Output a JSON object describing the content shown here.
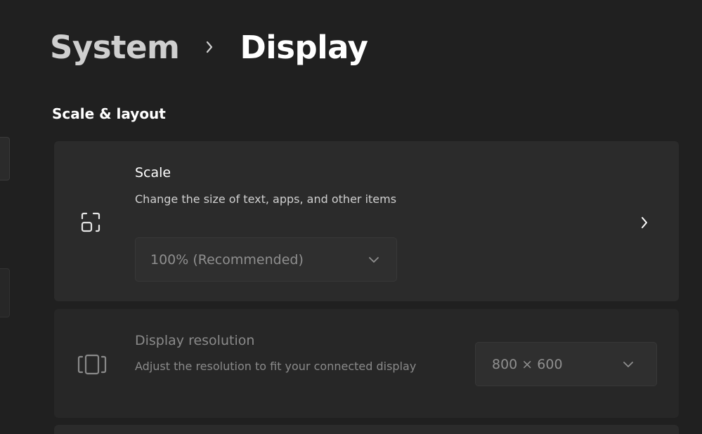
{
  "breadcrumb": {
    "parent": "System",
    "current": "Display"
  },
  "section": {
    "title": "Scale & layout"
  },
  "scale": {
    "title": "Scale",
    "description": "Change the size of text, apps, and other items",
    "dropdown_value": "100% (Recommended)",
    "icon": "scale-icon"
  },
  "resolution": {
    "title": "Display resolution",
    "description": "Adjust the resolution to fit your connected display",
    "dropdown_value": "800 × 600",
    "icon": "resolution-icon"
  },
  "colors": {
    "background": "#202020",
    "card": "#2b2b2b",
    "disabled_text": "#8a8a8a"
  }
}
